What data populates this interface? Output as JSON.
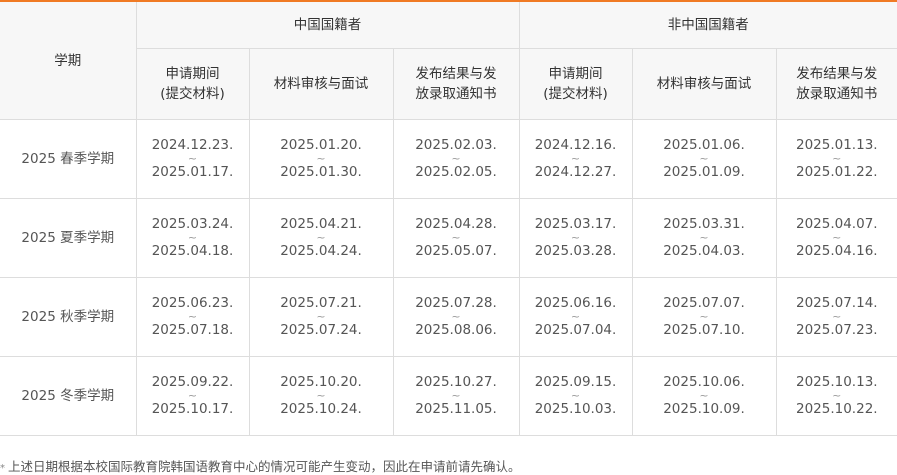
{
  "table": {
    "term_header": "学期",
    "groups": [
      {
        "title": "中国国籍者",
        "columns": [
          "申请期间\n(提交材料)",
          "材料审核与面试",
          "发布结果与发\n放录取通知书"
        ]
      },
      {
        "title": "非中国国籍者",
        "columns": [
          "申请期间\n(提交材料)",
          "材料审核与面试",
          "发布结果与发\n放录取通知书"
        ]
      }
    ],
    "range_separator": "~",
    "rows": [
      {
        "term": "2025 春季学期",
        "cells": [
          {
            "from": "2024.12.23.",
            "to": "2025.01.17."
          },
          {
            "from": "2025.01.20.",
            "to": "2025.01.30."
          },
          {
            "from": "2025.02.03.",
            "to": "2025.02.05."
          },
          {
            "from": "2024.12.16.",
            "to": "2024.12.27."
          },
          {
            "from": "2025.01.06.",
            "to": "2025.01.09."
          },
          {
            "from": "2025.01.13.",
            "to": "2025.01.22."
          }
        ]
      },
      {
        "term": "2025 夏季学期",
        "cells": [
          {
            "from": "2025.03.24.",
            "to": "2025.04.18."
          },
          {
            "from": "2025.04.21.",
            "to": "2025.04.24."
          },
          {
            "from": "2025.04.28.",
            "to": "2025.05.07."
          },
          {
            "from": "2025.03.17.",
            "to": "2025.03.28."
          },
          {
            "from": "2025.03.31.",
            "to": "2025.04.03."
          },
          {
            "from": "2025.04.07.",
            "to": "2025.04.16."
          }
        ]
      },
      {
        "term": "2025 秋季学期",
        "cells": [
          {
            "from": "2025.06.23.",
            "to": "2025.07.18."
          },
          {
            "from": "2025.07.21.",
            "to": "2025.07.24."
          },
          {
            "from": "2025.07.28.",
            "to": "2025.08.06."
          },
          {
            "from": "2025.06.16.",
            "to": "2025.07.04."
          },
          {
            "from": "2025.07.07.",
            "to": "2025.07.10."
          },
          {
            "from": "2025.07.14.",
            "to": "2025.07.23."
          }
        ]
      },
      {
        "term": "2025 冬季学期",
        "cells": [
          {
            "from": "2025.09.22.",
            "to": "2025.10.17."
          },
          {
            "from": "2025.10.20.",
            "to": "2025.10.24."
          },
          {
            "from": "2025.10.27.",
            "to": "2025.11.05."
          },
          {
            "from": "2025.09.15.",
            "to": "2025.10.03."
          },
          {
            "from": "2025.10.06.",
            "to": "2025.10.09."
          },
          {
            "from": "2025.10.13.",
            "to": "2025.10.22."
          }
        ]
      }
    ]
  },
  "note": {
    "marker": "*",
    "text": "上述日期根据本校国际教育院韩国语教育中心的情况可能产生变动，因此在申请前请先确认。"
  },
  "colors": {
    "accent_top_border": "#f07a24",
    "header_bg": "#f7f7f7",
    "grid_line": "#dddddd"
  }
}
